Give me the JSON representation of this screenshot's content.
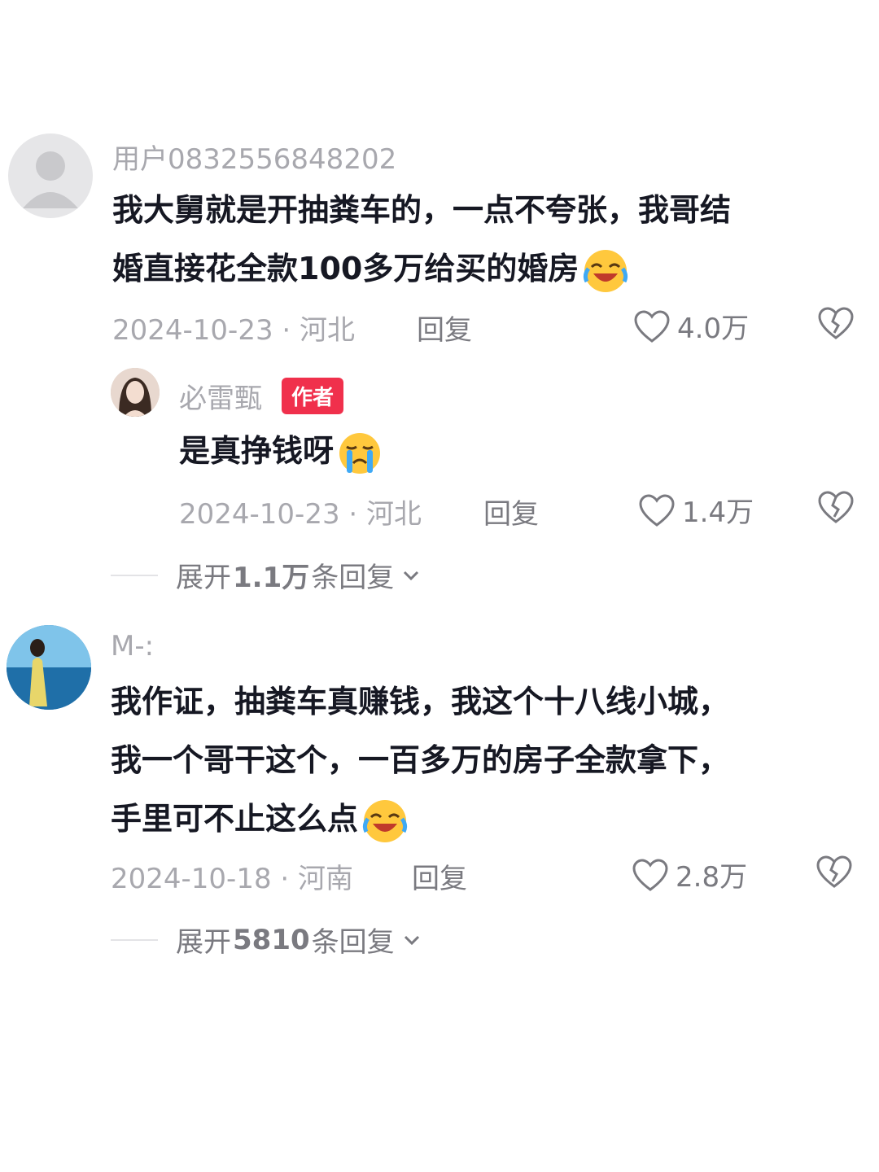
{
  "comments": [
    {
      "username": "用户0832556848202",
      "lines": [
        "我大舅就是开抽粪车的，一点不夸张，我哥结",
        "婚直接花全款100多万给买的婚房"
      ],
      "emoji": "laughing-crying-emoji",
      "date_location": "2024-10-23 · 河北",
      "reply_label": "回复",
      "likes": "4.0万",
      "replies": [
        {
          "username": "必雷甄",
          "badge": "作者",
          "text": "是真挣钱呀",
          "emoji": "crying-emoji",
          "date_location": "2024-10-23 · 河北",
          "reply_label": "回复",
          "likes": "1.4万"
        }
      ],
      "expand": {
        "prefix": "展开",
        "count": "1.1万",
        "suffix": "条回复"
      }
    },
    {
      "username": "M-:",
      "lines": [
        "我作证，抽粪车真赚钱，我这个十八线小城，",
        "我一个哥干这个，一百多万的房子全款拿下，",
        "手里可不止这么点"
      ],
      "emoji": "laughing-crying-emoji",
      "date_location": "2024-10-18 · 河南",
      "reply_label": "回复",
      "likes": "2.8万",
      "expand": {
        "prefix": "展开",
        "count": "5810",
        "suffix": "条回复"
      }
    }
  ],
  "colors": {
    "badge": "#f0304c",
    "muted_text": "#a8a8ae",
    "main_text": "#161823"
  }
}
